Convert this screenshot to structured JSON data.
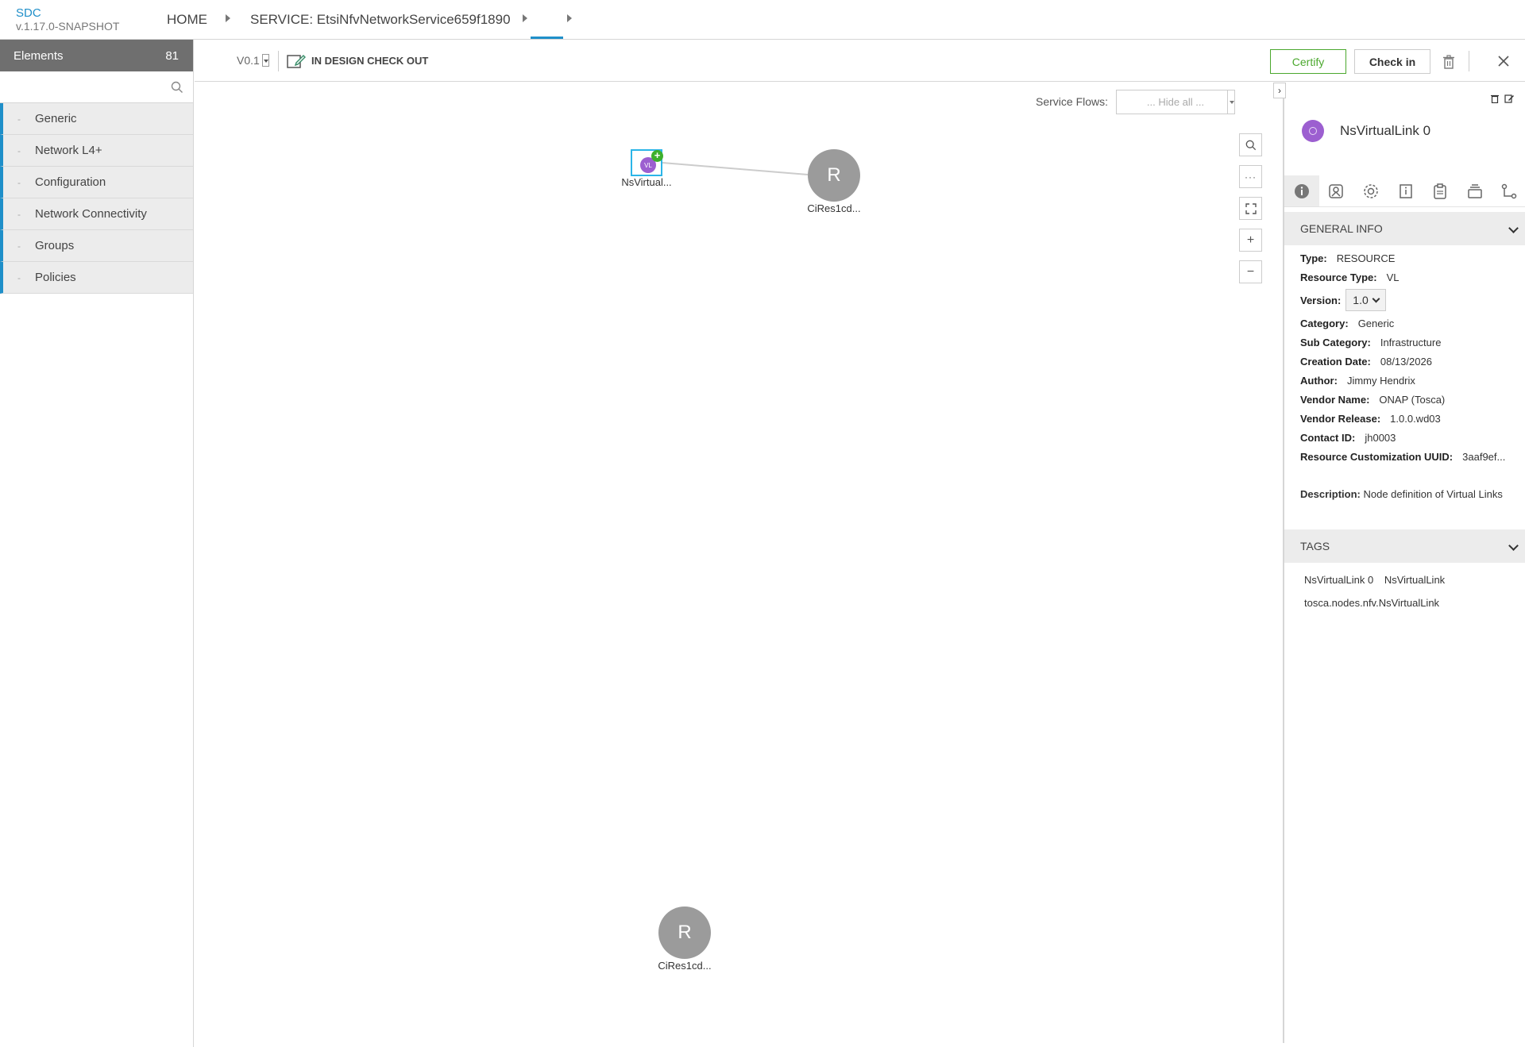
{
  "header": {
    "brand": "SDC",
    "version": "v.1.17.0-SNAPSHOT",
    "breadcrumbs": [
      "HOME",
      "SERVICE: EtsiNfvNetworkService659f1890"
    ]
  },
  "palette": {
    "title": "Elements",
    "count": "81",
    "search_placeholder": "",
    "categories": [
      "Generic",
      "Network L4+",
      "Configuration",
      "Network Connectivity",
      "Groups",
      "Policies"
    ]
  },
  "toolbar": {
    "version": "V0.1",
    "status": "IN DESIGN CHECK OUT",
    "certify": "Certify",
    "checkin": "Check in"
  },
  "canvas": {
    "service_flows_label": "Service Flows:",
    "service_flows_value": "... Hide all ...",
    "zoom_buttons": [
      "search-icon",
      "more-icon",
      "fit-icon",
      "plus-icon",
      "minus-icon"
    ],
    "nodes": [
      {
        "label": "NsVirtual...",
        "icon_text": "VL"
      },
      {
        "label": "CiRes1cd...",
        "icon_text": "R"
      },
      {
        "label": "CiRes1cd...",
        "icon_text": "R"
      }
    ]
  },
  "panel": {
    "title": "NsVirtualLink 0",
    "general_info_title": "GENERAL INFO",
    "fields": {
      "type_label": "Type:",
      "type": "RESOURCE",
      "resource_type_label": "Resource Type:",
      "resource_type": "VL",
      "version_label": "Version:",
      "version": "1.0",
      "category_label": "Category:",
      "category": "Generic",
      "sub_category_label": "Sub Category:",
      "sub_category": "Infrastructure",
      "creation_date_label": "Creation Date:",
      "creation_date": "08/13/2026",
      "author_label": "Author:",
      "author": "Jimmy Hendrix",
      "vendor_name_label": "Vendor Name:",
      "vendor_name": "ONAP (Tosca)",
      "vendor_release_label": "Vendor Release:",
      "vendor_release": "1.0.0.wd03",
      "contact_id_label": "Contact ID:",
      "contact_id": "jh0003",
      "uuid_label": "Resource Customization UUID:",
      "uuid": "3aaf9ef..."
    },
    "description_label": "Description:",
    "description": "Node definition of Virtual Links",
    "tags_title": "TAGS",
    "tags": [
      "NsVirtualLink 0",
      "NsVirtualLink",
      "tosca.nodes.nfv.NsVirtualLink"
    ]
  },
  "colors": {
    "accent": "#1f8fc9",
    "certify": "#4ba82e",
    "vl_node": "#9c5fd0",
    "resource_node": "#9b9b9b"
  }
}
